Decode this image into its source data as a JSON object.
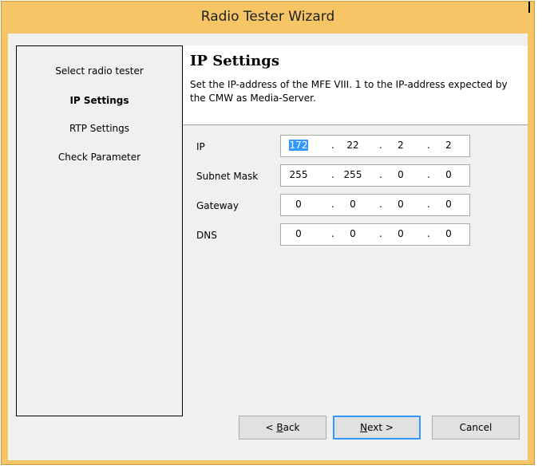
{
  "window": {
    "title": "Radio Tester Wizard"
  },
  "steps": [
    {
      "label": "Select radio tester",
      "active": false
    },
    {
      "label": "IP Settings",
      "active": true
    },
    {
      "label": "RTP Settings",
      "active": false
    },
    {
      "label": "Check Parameter",
      "active": false
    }
  ],
  "header": {
    "title": "IP Settings",
    "description": "Set the IP-address of the MFE VIII. 1 to the IP-address expected by the CMW as Media-Server."
  },
  "fields": [
    {
      "label": "IP",
      "octets": [
        "172",
        "22",
        "2",
        "2"
      ],
      "selected_octet": 0
    },
    {
      "label": "Subnet Mask",
      "octets": [
        "255",
        "255",
        "0",
        "0"
      ]
    },
    {
      "label": "Gateway",
      "octets": [
        "0",
        "0",
        "0",
        "0"
      ]
    },
    {
      "label": "DNS",
      "octets": [
        "0",
        "0",
        "0",
        "0"
      ]
    }
  ],
  "separator": ".",
  "buttons": {
    "back": {
      "mnemonic": "B",
      "rest": "ack",
      "prefix": "< "
    },
    "next": {
      "mnemonic": "N",
      "rest": "ext >"
    },
    "cancel": {
      "label": "Cancel"
    }
  },
  "colors": {
    "title_bar": "#f6c666",
    "selection": "#3399ff"
  }
}
